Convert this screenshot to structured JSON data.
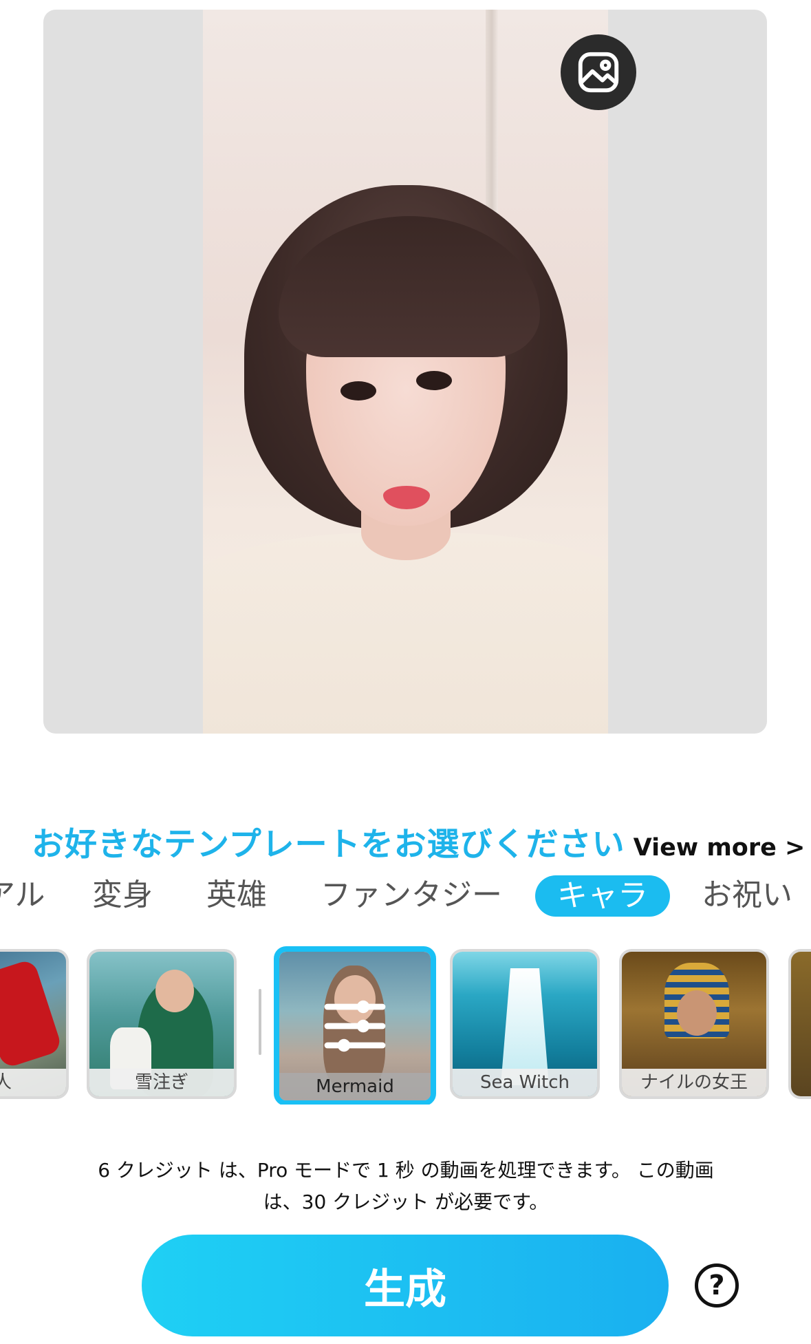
{
  "preview": {
    "gallery_icon": "image-gallery-icon"
  },
  "header": {
    "title": "お好きなテンプレートをお選びください",
    "view_more": "View more >"
  },
  "categories": [
    {
      "label": "アル",
      "active": false
    },
    {
      "label": "変身",
      "active": false
    },
    {
      "label": "英雄",
      "active": false
    },
    {
      "label": "ファンタジー",
      "active": false
    },
    {
      "label": "キャラ",
      "active": true
    },
    {
      "label": "お祝い",
      "active": false
    }
  ],
  "templates": [
    {
      "label": "巨人",
      "selected": false
    },
    {
      "label": "雪注ぎ",
      "selected": false
    },
    {
      "label": "Mermaid",
      "selected": true
    },
    {
      "label": "Sea Witch",
      "selected": false
    },
    {
      "label": "ナイルの女王",
      "selected": false
    }
  ],
  "credits": {
    "line1": "6 クレジット は、Pro モードで 1 秒 の動画を処理できます。 この動画",
    "line2": "は、30 クレジット が必要です。"
  },
  "generate_button": "生成",
  "help_button": "?",
  "colors": {
    "accent": "#1bbcf0",
    "title": "#1eb3ea",
    "selected_border": "#19c0f5"
  }
}
